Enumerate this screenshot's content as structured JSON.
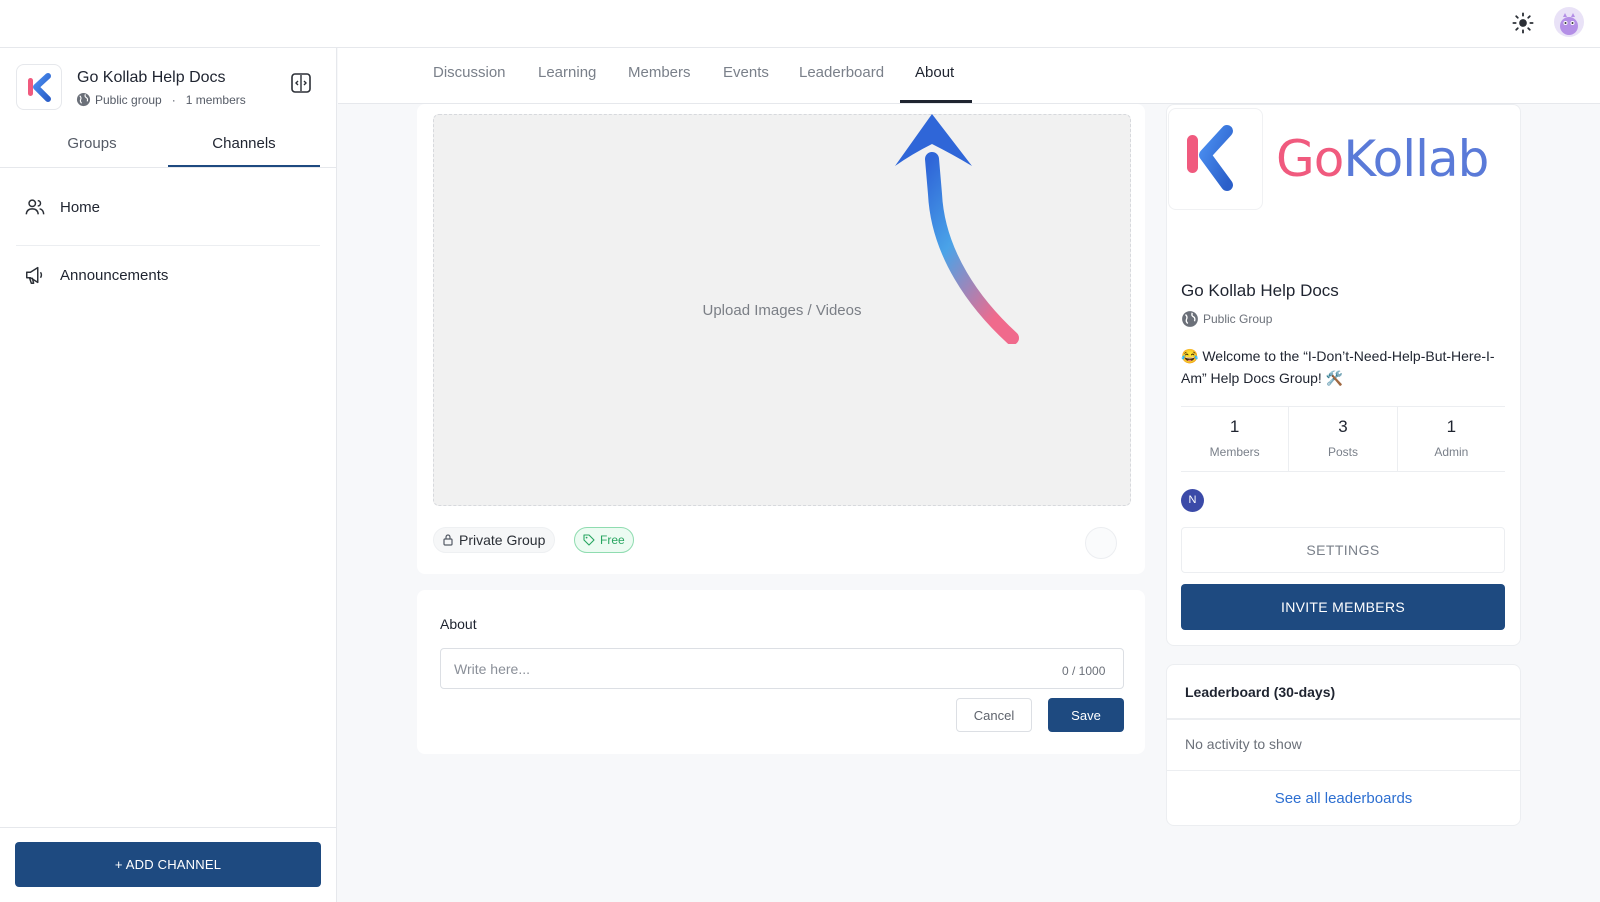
{
  "group": {
    "name": "Go Kollab Help Docs",
    "visibility": "Public group",
    "separator": "·",
    "members_count": "1 members"
  },
  "sidebar": {
    "tabs": [
      {
        "label": "Groups",
        "active": false
      },
      {
        "label": "Channels",
        "active": true
      }
    ],
    "items": [
      {
        "label": "Home",
        "icon": "people-icon"
      },
      {
        "label": "Announcements",
        "icon": "megaphone-icon"
      }
    ],
    "add_channel": "+ ADD CHANNEL"
  },
  "nav": {
    "tabs": [
      {
        "label": "Discussion"
      },
      {
        "label": "Learning"
      },
      {
        "label": "Members"
      },
      {
        "label": "Events"
      },
      {
        "label": "Leaderboard"
      },
      {
        "label": "About",
        "active": true
      }
    ]
  },
  "media": {
    "upload_text": "Upload Images / Videos",
    "privacy_chip": "Private Group",
    "price_chip": "Free"
  },
  "about": {
    "title": "About",
    "placeholder": "Write here...",
    "counter": "0 / 1000",
    "cancel": "Cancel",
    "save": "Save"
  },
  "group_card": {
    "brand_go": "Go",
    "brand_kollab": "Kollab",
    "title": "Go Kollab Help Docs",
    "visibility": "Public Group",
    "description": "😂 Welcome to the “I-Don’t-Need-Help-But-Here-I-Am” Help Docs Group! 🛠️",
    "stats": [
      {
        "value": "1",
        "label": "Members"
      },
      {
        "value": "3",
        "label": "Posts"
      },
      {
        "value": "1",
        "label": "Admin"
      }
    ],
    "member_initial": "N",
    "settings": "SETTINGS",
    "invite": "INVITE MEMBERS"
  },
  "leaderboard": {
    "title": "Leaderboard (30-days)",
    "empty": "No activity to show",
    "link": "See all leaderboards"
  },
  "colors": {
    "primary": "#1e4a80",
    "brand_pink": "#f05a7e",
    "brand_blue": "#5a7ad8",
    "link": "#2d6fd1",
    "free_green": "#27a560"
  }
}
